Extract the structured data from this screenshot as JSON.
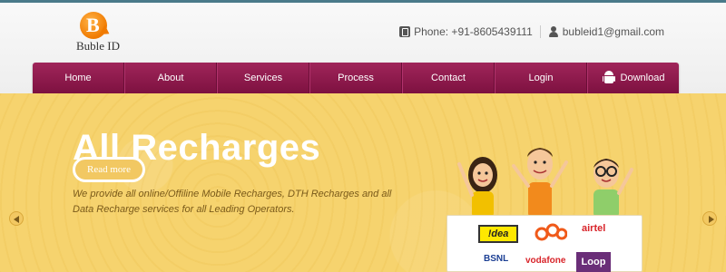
{
  "brand": {
    "logo_letter": "B",
    "name": "Buble ID"
  },
  "contact": {
    "phone": "Phone: +91-8605439111",
    "email": "bubleid1@gmail.com"
  },
  "nav": {
    "items": [
      {
        "label": "Home"
      },
      {
        "label": "About"
      },
      {
        "label": "Services"
      },
      {
        "label": "Process"
      },
      {
        "label": "Contact"
      },
      {
        "label": "Login"
      },
      {
        "label": "Download"
      }
    ]
  },
  "hero": {
    "title": "All Recharges",
    "description": "We provide all online/Offiline Mobile Recharges, DTH Recharges and all Data Recharge services for all Leading Operators.",
    "button": "Read more"
  },
  "operators": {
    "idea": "!dea",
    "airtel": "airtel",
    "bsnl": "BSNL",
    "vodafone": "vodafone",
    "loop": "Loop"
  },
  "colors": {
    "nav_top": "#a0255a",
    "nav_bottom": "#7d1140",
    "hero_bg": "#f6d36e",
    "logo_orange": "#f07a00"
  }
}
